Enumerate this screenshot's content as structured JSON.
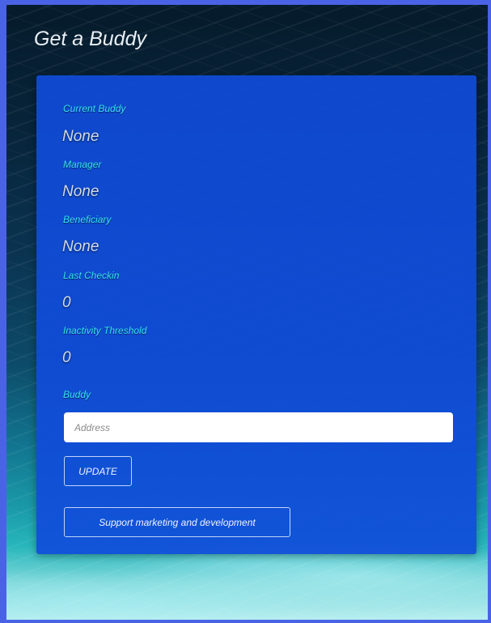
{
  "page": {
    "title": "Get a Buddy"
  },
  "fields": [
    {
      "label": "Current Buddy",
      "value": "None"
    },
    {
      "label": "Manager",
      "value": "None"
    },
    {
      "label": "Beneficiary",
      "value": "None"
    },
    {
      "label": "Last Checkin",
      "value": "0"
    },
    {
      "label": "Inactivity Threshold",
      "value": "0"
    }
  ],
  "buddy_form": {
    "label": "Buddy",
    "address_placeholder": "Address",
    "address_value": "",
    "update_label": "UPDATE",
    "support_label": "Support marketing and development"
  },
  "colors": {
    "frame_border": "#4a63e6",
    "card_background": "#104cda",
    "label_color": "#38e2f0",
    "value_color": "#d0dbe8"
  }
}
